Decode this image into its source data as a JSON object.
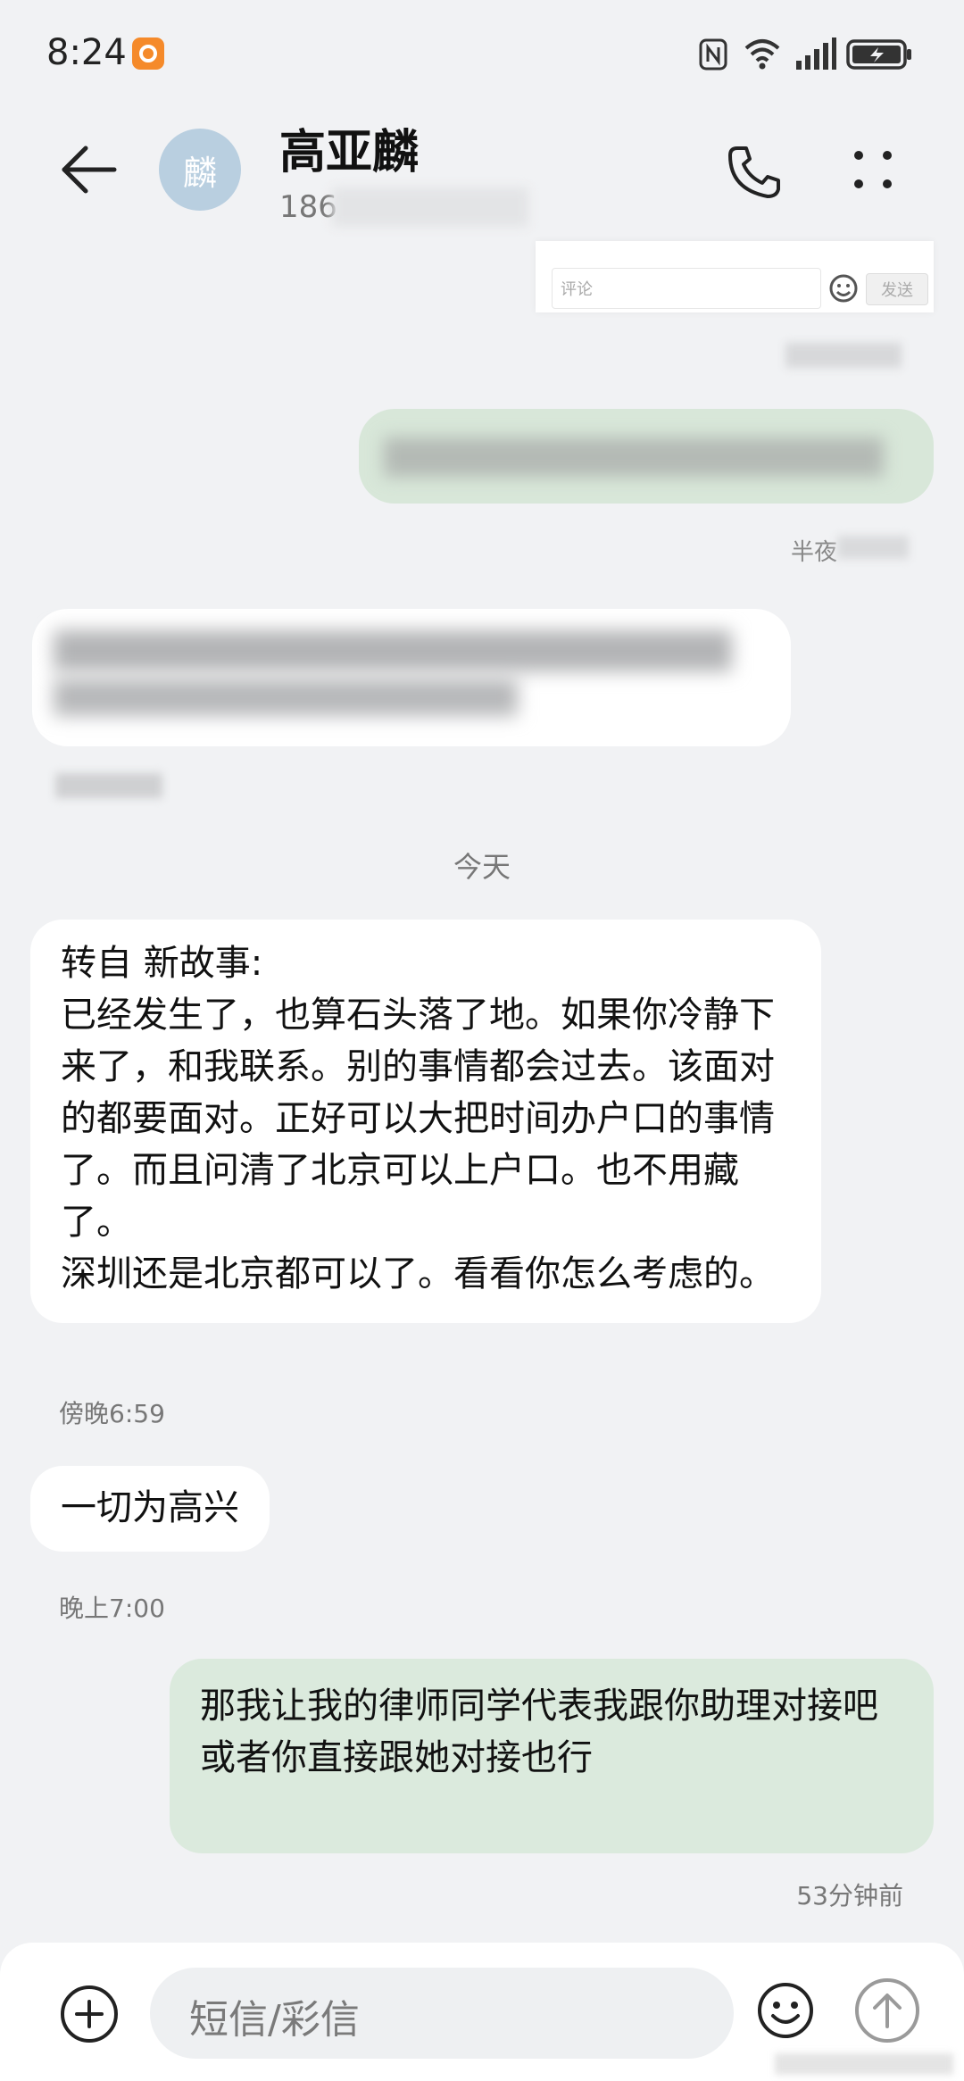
{
  "status_bar": {
    "time": "8:24"
  },
  "header": {
    "avatar_text": "麟",
    "contact_name": "高亚麟",
    "contact_number_prefix": "186"
  },
  "blurred_fragment": {
    "input_placeholder": "评论",
    "send_label": "发送"
  },
  "conversation": {
    "partial_time_label": "半夜",
    "date_separator": "今天",
    "messages": [
      {
        "direction": "incoming",
        "text": "转自 新故事:\n已经发生了，也算石头落了地。如果你冷静下来了，和我联系。别的事情都会过去。该面对的都要面对。正好可以大把时间办户口的事情了。而且问清了北京可以上户口。也不用藏了。\n深圳还是北京都可以了。看看你怎么考虑的。",
        "time": "傍晚6:59"
      },
      {
        "direction": "incoming",
        "text": "一切为高兴",
        "time": "晚上7:00"
      },
      {
        "direction": "outgoing",
        "text": "那我让我的律师同学代表我跟你助理对接吧 或者你直接跟她对接也行",
        "time": "53分钟前"
      }
    ]
  },
  "composer": {
    "placeholder": "短信/彩信"
  },
  "colors": {
    "background": "#f1f2f4",
    "incoming_bubble": "#ffffff",
    "outgoing_bubble": "#dbeadd",
    "avatar": "#b9cfe0",
    "app_badge": "#f58a2a"
  }
}
